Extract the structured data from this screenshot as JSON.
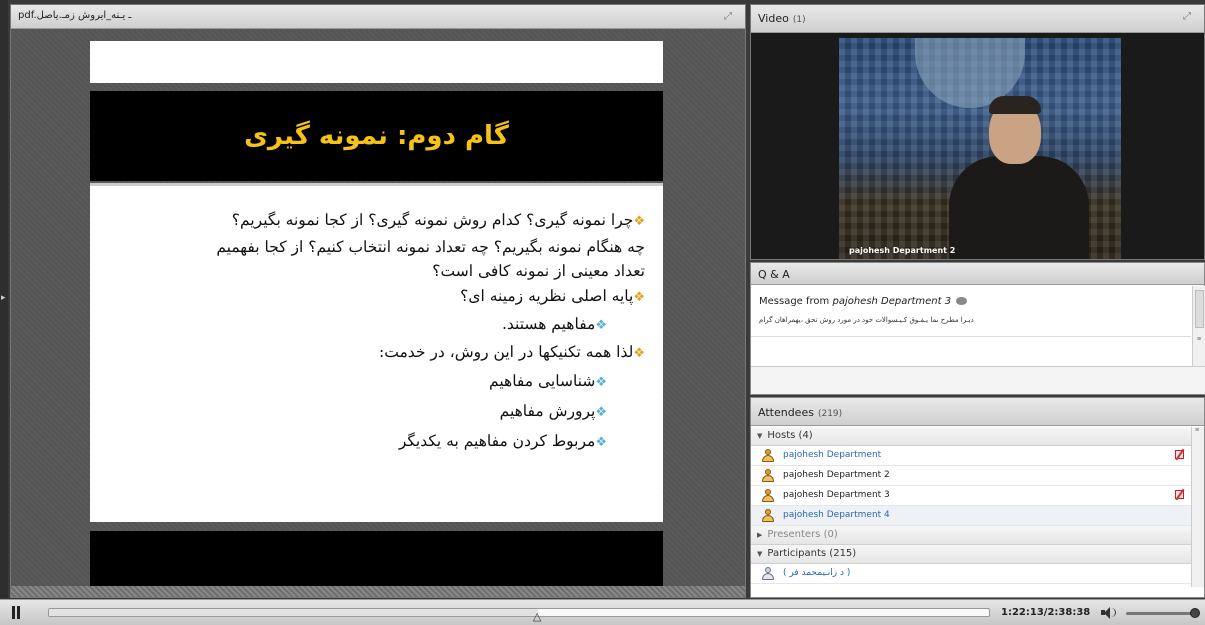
{
  "share_pod": {
    "filename": "pdf.ـ یـنه_ایروش زمـ.یاصل",
    "slide": {
      "title": "گام دوم: نمونه گیری",
      "lines": [
        {
          "text": "چرا نمونه گیری؟ کدام روش نمونه گیری؟ از کجا نمونه بگیریم؟",
          "bullet": true,
          "sub": false
        },
        {
          "text": "چه هنگام نمونه بگیریم؟ چه تعداد نمونه انتخاب کنیم؟ از کجا بفهمیم",
          "bullet": false,
          "sub": false
        },
        {
          "text": "تعداد معینی از نمونه کافی است؟",
          "bullet": false,
          "sub": false
        },
        {
          "text": "پایه اصلی نظریه زمینه ای؟",
          "bullet": true,
          "sub": false
        },
        {
          "text": "مفاهیم هستند.",
          "bullet": true,
          "sub": true
        },
        {
          "text": "لذا همه تکنیکها در این روش، در خدمت:",
          "bullet": true,
          "sub": false
        },
        {
          "text": "شناسایی مفاهیم",
          "bullet": true,
          "sub": true
        },
        {
          "text": "پرورش مفاهیم",
          "bullet": true,
          "sub": true
        },
        {
          "text": "مربوط کردن مفاهیم به یکدیگر",
          "bullet": true,
          "sub": true
        }
      ]
    }
  },
  "video_pod": {
    "title": "Video",
    "count": "(1)",
    "caption": "pajohesh Department 2"
  },
  "qa_pod": {
    "title": "Q & A",
    "message_prefix": "Message from",
    "message_sender": "pajohesh Department 3",
    "message_text": "دیـرا مطرح نما یـقـوق کـیـسوالات حود در مورد روش تحق ،یهمراهان گرام"
  },
  "attendees_pod": {
    "title": "Attendees",
    "count": "(219)",
    "hosts_label": "Hosts (4)",
    "hosts": [
      {
        "name": "pajohesh Department",
        "color": "blue",
        "edit": true
      },
      {
        "name": "pajohesh Department 2",
        "color": "dark",
        "edit": false
      },
      {
        "name": "pajohesh Department 3",
        "color": "dark",
        "edit": true
      },
      {
        "name": "pajohesh Department 4",
        "color": "blue",
        "edit": false
      }
    ],
    "presenters_label": "Presenters (0)",
    "participants_label": "Participants (215)",
    "participants": [
      {
        "name": "( د زانـیمحمد فر )"
      }
    ]
  },
  "playback": {
    "time": "1:22:13/2:38:38",
    "progress": 0.52,
    "volume": 1.0
  },
  "icons": [
    "pause-icon",
    "maximize-icon",
    "chat-icon",
    "user-icon",
    "edit-icon",
    "speaker-icon"
  ],
  "colors": {
    "slide_title": "#f6c21a",
    "bullet_main": "#e0a020",
    "bullet_sub": "#5bb0d0",
    "link_blue": "#2a66b5"
  }
}
